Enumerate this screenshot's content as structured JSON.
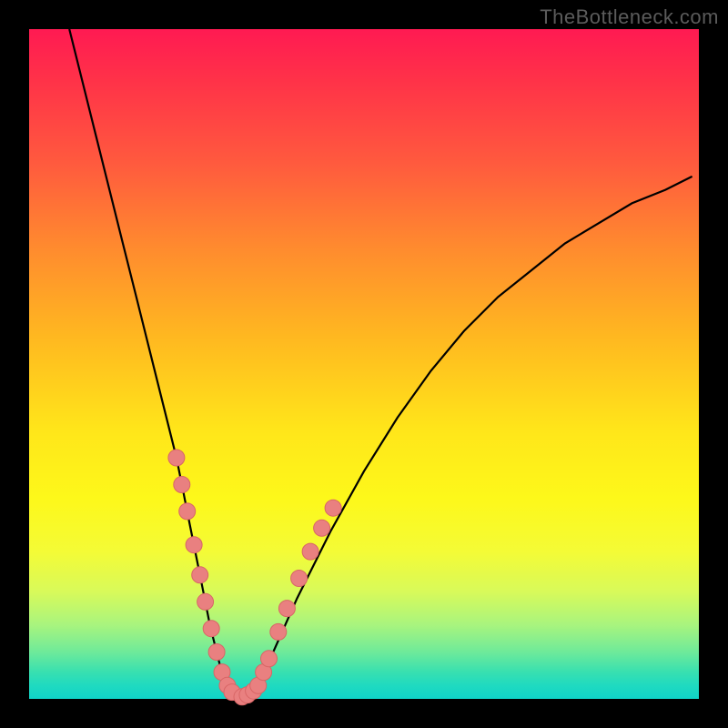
{
  "watermark": "TheBottleneck.com",
  "colors": {
    "frame": "#000000",
    "curve_stroke": "#000000",
    "marker_fill": "#e98080",
    "marker_stroke": "#d86666",
    "gradient_stops": [
      "#ff1a52",
      "#ff3348",
      "#ff5a3e",
      "#ff8c2e",
      "#ffb820",
      "#ffe61a",
      "#fdf81a",
      "#f4fb36",
      "#d8fa5a",
      "#a8f47e",
      "#6eea9a",
      "#38e0b0",
      "#1fdac0",
      "#10d4c8"
    ]
  },
  "chart_data": {
    "type": "line",
    "title": "",
    "xlabel": "",
    "ylabel": "",
    "xlim": [
      0,
      100
    ],
    "ylim": [
      0,
      100
    ],
    "grid": false,
    "legend": false,
    "series": [
      {
        "name": "bottleneck-curve",
        "x": [
          6,
          8,
          10,
          12,
          14,
          16,
          18,
          20,
          22,
          23,
          24,
          25,
          26,
          27,
          28,
          29,
          30,
          31,
          32,
          33,
          34,
          36,
          40,
          45,
          50,
          55,
          60,
          65,
          70,
          75,
          80,
          85,
          90,
          95,
          99
        ],
        "y": [
          100,
          92,
          84,
          76,
          68,
          60,
          52,
          44,
          36,
          31,
          26,
          21,
          16,
          11,
          7,
          3,
          0.5,
          0,
          0,
          0.5,
          2,
          6,
          15,
          25,
          34,
          42,
          49,
          55,
          60,
          64,
          68,
          71,
          74,
          76,
          78
        ]
      }
    ],
    "markers": [
      {
        "x": 22.0,
        "y": 36.0
      },
      {
        "x": 22.8,
        "y": 32.0
      },
      {
        "x": 23.6,
        "y": 28.0
      },
      {
        "x": 24.6,
        "y": 23.0
      },
      {
        "x": 25.5,
        "y": 18.5
      },
      {
        "x": 26.3,
        "y": 14.5
      },
      {
        "x": 27.2,
        "y": 10.5
      },
      {
        "x": 28.0,
        "y": 7.0
      },
      {
        "x": 28.8,
        "y": 4.0
      },
      {
        "x": 29.6,
        "y": 2.0
      },
      {
        "x": 30.3,
        "y": 1.0
      },
      {
        "x": 31.8,
        "y": 0.3
      },
      {
        "x": 32.6,
        "y": 0.6
      },
      {
        "x": 33.5,
        "y": 1.2
      },
      {
        "x": 34.2,
        "y": 2.0
      },
      {
        "x": 35.0,
        "y": 4.0
      },
      {
        "x": 35.8,
        "y": 6.0
      },
      {
        "x": 37.2,
        "y": 10.0
      },
      {
        "x": 38.5,
        "y": 13.5
      },
      {
        "x": 40.3,
        "y": 18.0
      },
      {
        "x": 42.0,
        "y": 22.0
      },
      {
        "x": 43.7,
        "y": 25.5
      },
      {
        "x": 45.4,
        "y": 28.5
      }
    ]
  }
}
